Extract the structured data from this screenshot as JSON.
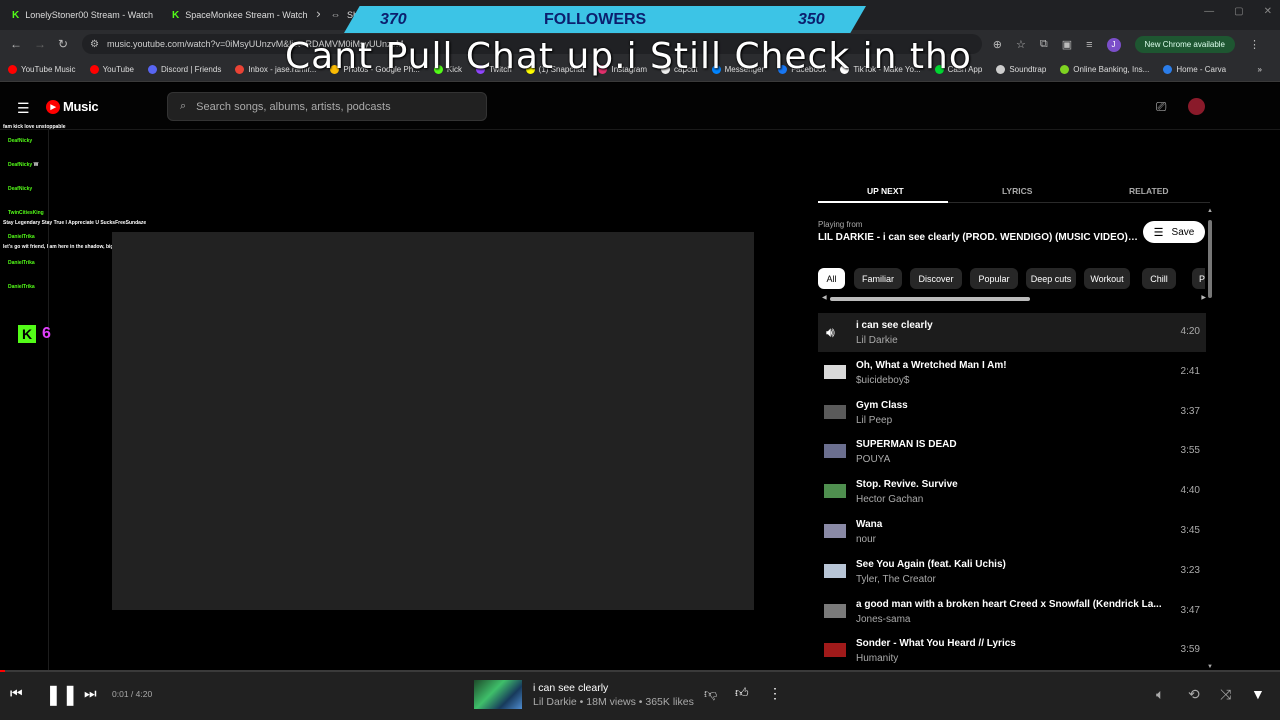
{
  "browser": {
    "tabs": [
      {
        "title": "LonelyStoner00 Stream - Watch",
        "icon": "kick-icon"
      },
      {
        "title": "SpaceMonkee Stream - Watch",
        "icon": "kick-icon"
      },
      {
        "title": "Shi",
        "icon": "link-icon"
      }
    ],
    "url": "music.youtube.com/watch?v=0iMsyUUnzvM&list=RDAMVM0iMsyUUnzvM",
    "new_chrome": "New Chrome available",
    "profile_initial": "J",
    "bookmarks": [
      {
        "label": "YouTube Music",
        "color": "#ff0000"
      },
      {
        "label": "YouTube",
        "color": "#ff0000"
      },
      {
        "label": "Discord | Friends",
        "color": "#5865f2"
      },
      {
        "label": "Inbox - jase.ramir...",
        "color": "#ea4335"
      },
      {
        "label": "Photos - Google Ph...",
        "color": "#fbbc04"
      },
      {
        "label": "Kick",
        "color": "#53fc18"
      },
      {
        "label": "Twitch",
        "color": "#9146ff"
      },
      {
        "label": "(1) Snapchat",
        "color": "#fffc00"
      },
      {
        "label": "Instagram",
        "color": "#e1306c"
      },
      {
        "label": "capcut",
        "color": "#eeeeee"
      },
      {
        "label": "Messenger",
        "color": "#0084ff"
      },
      {
        "label": "Facebook",
        "color": "#1877f2"
      },
      {
        "label": "TikTok - Make Yo...",
        "color": "#ffffff"
      },
      {
        "label": "Cash App",
        "color": "#00d632"
      },
      {
        "label": "Soundtrap",
        "color": "#cccccc"
      },
      {
        "label": "Online Banking, Ins...",
        "color": "#7ed321"
      },
      {
        "label": "Home - Carva",
        "color": "#2b7de9"
      }
    ]
  },
  "overlay": {
    "followers_left": "370",
    "followers_label": "FOLLOWERS",
    "followers_right": "350",
    "caption": "Cant Pull Chat up.i Still Check in tho",
    "kick_count": "6",
    "chat": [
      {
        "name": "",
        "msg": "fam kick love unstoppable"
      },
      {
        "name": "DeafNicky",
        "msg": ""
      },
      {
        "name": "DeafNicky",
        "msg": "W"
      },
      {
        "name": "DeafNicky",
        "msg": ""
      },
      {
        "name": "TwinCitiesKing",
        "msg": ""
      },
      {
        "name": "",
        "msg": "Stay Legendary Stay True I Appreciate U SucksFreeSundaze"
      },
      {
        "name": "DanielTrika",
        "msg": ""
      },
      {
        "name": "",
        "msg": "let's go wit friend, I am here in the shadow, big hug"
      },
      {
        "name": "DanielTrika",
        "msg": ""
      },
      {
        "name": "DanielTrika",
        "msg": ""
      }
    ]
  },
  "ytm": {
    "logo": "Music",
    "search_placeholder": "Search songs, albums, artists, podcasts",
    "tabs": [
      "UP NEXT",
      "LYRICS",
      "RELATED"
    ],
    "playing_from_label": "Playing from",
    "playlist_title": "LIL DARKIE - i can see clearly (PROD. WENDIGO) (MUSIC VIDEO) R...",
    "save_label": "Save",
    "chips": [
      "All",
      "Familiar",
      "Discover",
      "Popular",
      "Deep cuts",
      "Workout",
      "Chill",
      "P"
    ],
    "queue": [
      {
        "title": "i can see clearly",
        "artist": "Lil Darkie",
        "duration": "4:20",
        "thumb": "#2a2a2a"
      },
      {
        "title": "Oh, What a Wretched Man I Am!",
        "artist": "$uicideboy$",
        "duration": "2:41",
        "thumb": "#d9d9d9"
      },
      {
        "title": "Gym Class",
        "artist": "Lil Peep",
        "duration": "3:37",
        "thumb": "#5a5a5a"
      },
      {
        "title": "SUPERMAN IS DEAD",
        "artist": "POUYA",
        "duration": "3:55",
        "thumb": "#6b6f8f"
      },
      {
        "title": "Stop. Revive. Survive",
        "artist": "Hector Gachan",
        "duration": "4:40",
        "thumb": "#4f8f4f"
      },
      {
        "title": "Wana",
        "artist": "nour",
        "duration": "3:45",
        "thumb": "#8a8aa6"
      },
      {
        "title": "See You Again (feat. Kali Uchis)",
        "artist": "Tyler, The Creator",
        "duration": "3:23",
        "thumb": "#b8c5d6"
      },
      {
        "title": "a good man with a broken heart Creed x Snowfall (Kendrick La...",
        "artist": "Jones-sama",
        "duration": "3:47",
        "thumb": "#7a7a7a"
      },
      {
        "title": "Sonder - What You Heard // Lyrics",
        "artist": "Humanity",
        "duration": "3:59",
        "thumb": "#a01a1a"
      }
    ]
  },
  "player": {
    "time": "0:01 / 4:20",
    "progress": 0.004,
    "title": "i can see clearly",
    "subtitle": "Lil Darkie • 18M views • 365K likes"
  }
}
